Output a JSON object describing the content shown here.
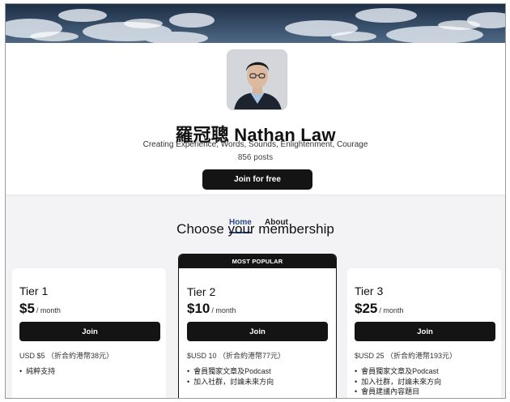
{
  "creator": {
    "name": "羅冠聰 Nathan Law",
    "tagline": "Creating Experience, Words, Sounds, Enlightenment, Courage",
    "post_count": "856 posts",
    "join_free_label": "Join for free"
  },
  "tabs": [
    {
      "label": "Home",
      "active": true
    },
    {
      "label": "About",
      "active": false
    }
  ],
  "membership": {
    "title": "Choose your membership",
    "tiers": [
      {
        "name": "Tier 1",
        "price": "$5",
        "period": "/ month",
        "join_label": "Join",
        "local_price": "USD $5  （折合約港幣38元）",
        "perks": [
          "純粹支持"
        ]
      },
      {
        "name": "Tier 2",
        "price": "$10",
        "period": "/ month",
        "join_label": "Join",
        "badge": "MOST POPULAR",
        "local_price": "$USD 10  （折合約港幣77元）",
        "perks": [
          "會員獨家文章及Podcast",
          "加入社群，討論未來方向"
        ]
      },
      {
        "name": "Tier 3",
        "price": "$25",
        "period": "/ month",
        "join_label": "Join",
        "local_price": "$USD 25  （折合約港幣193元）",
        "perks": [
          "會員獨家文章及Podcast",
          "加入社群，討論未來方向",
          "會員建議內容題目"
        ]
      }
    ]
  },
  "colors": {
    "accent": "#2d4a8a",
    "button": "#141414",
    "background": "#f3f3f5"
  }
}
